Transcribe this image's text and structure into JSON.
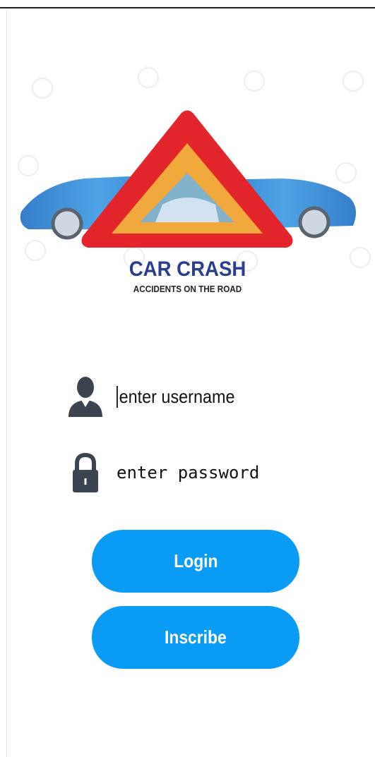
{
  "logo": {
    "title": "CAR CRASH",
    "subtitle": "ACCIDENTS ON THE ROAD"
  },
  "form": {
    "username": {
      "placeholder": "enter username",
      "value": "",
      "icon": "person-icon"
    },
    "password": {
      "placeholder": "enter password",
      "value": "",
      "icon": "lock-icon"
    }
  },
  "buttons": {
    "login_label": "Login",
    "inscribe_label": "Inscribe"
  },
  "colors": {
    "accent": "#0a9cf4",
    "logo_title": "#2a3d8f",
    "triangle_outer": "#e3262b",
    "triangle_inner": "#f2a93b",
    "car": "#2f86d6",
    "icon": "#3c4452"
  }
}
